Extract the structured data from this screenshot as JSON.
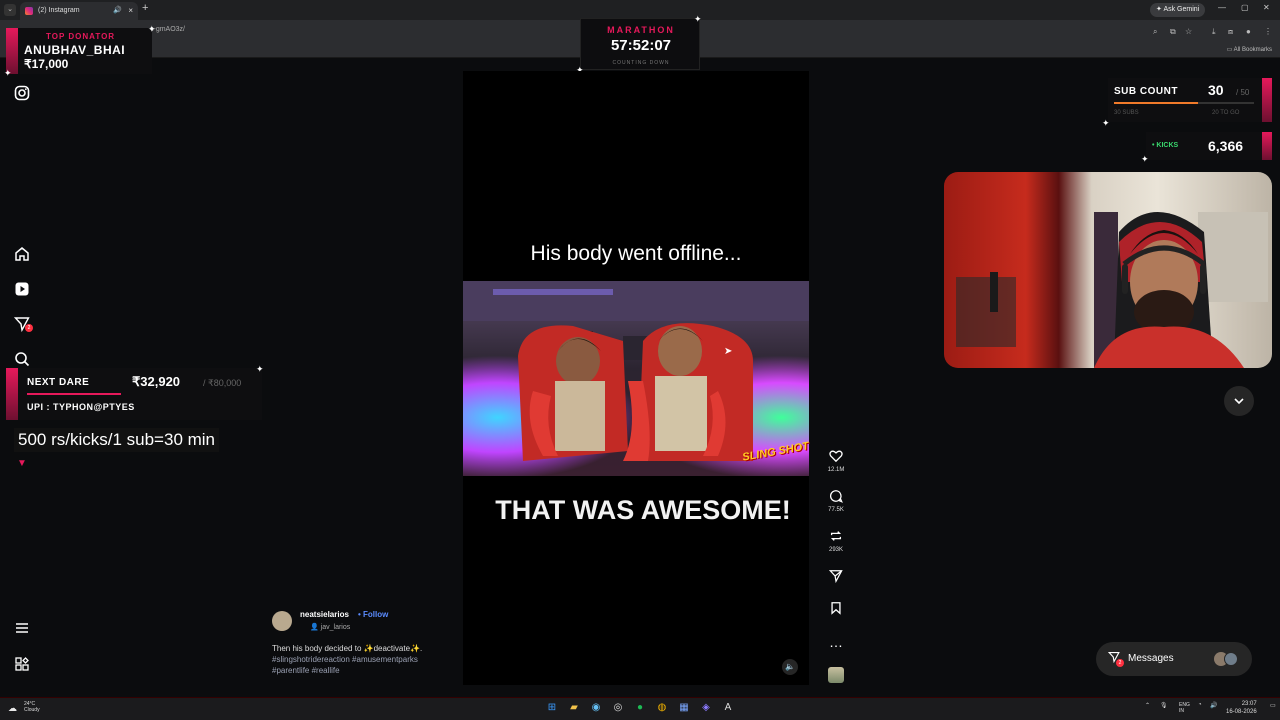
{
  "browser": {
    "tab_title": "(2) Instagram",
    "url_fragment": "s-gmAO3z/",
    "ask_gemini": "Ask Gemini",
    "all_bookmarks": "All Bookmarks"
  },
  "overlays": {
    "top_donator": {
      "label": "TOP DONATOR",
      "name": "ANUBHAV_BHAI",
      "amount": "₹17,000"
    },
    "marathon": {
      "title": "MARATHON",
      "countdown": "57:52:07",
      "subtitle": "COUNTING DOWN"
    },
    "sub_count": {
      "label": "SUB COUNT",
      "value": "30",
      "goal": "/ 50",
      "progress": 0.6,
      "small_left": "30 SUBS",
      "small_right": "20 TO GO"
    },
    "kicks": {
      "label": "• KICKS",
      "value": "6,366"
    },
    "next_dare": {
      "label": "NEXT DARE",
      "amount": "₹32,920",
      "goal": "/ ₹80,000",
      "progress": 0.41,
      "upi": "UPI : TYPHON@PTYES"
    },
    "rate_text": "500 rs/kicks/1 sub=30 min"
  },
  "reel": {
    "caption_top": "His body went offline...",
    "caption_bottom": "THAT WAS AWESOME!",
    "video_logo": "SLING SHOT",
    "author": "neatsielarios",
    "follow": "Follow",
    "sub_handle": "jav_larios",
    "description": "Then his body decided to ✨deactivate✨.",
    "hashtags": "#slingshotridereaction #amusementparks #parentlife #reallife"
  },
  "actions": {
    "likes": "12.1M",
    "comments": "77.5K",
    "reposts": "293K"
  },
  "rail": {
    "notifications_badge": "2"
  },
  "messages": {
    "label": "Messages",
    "badge": "2"
  },
  "taskbar": {
    "weather_temp": "24°C",
    "weather_desc": "Cloudy",
    "lang_top": "ENG",
    "lang_bottom": "IN",
    "time": "23:07",
    "date": "16-08-2026"
  },
  "colors": {
    "accent_pink": "#e6195b",
    "kicks_green": "#3ad86e",
    "progress_orange": "#f07a2a",
    "follow_blue": "#5b8cff"
  }
}
